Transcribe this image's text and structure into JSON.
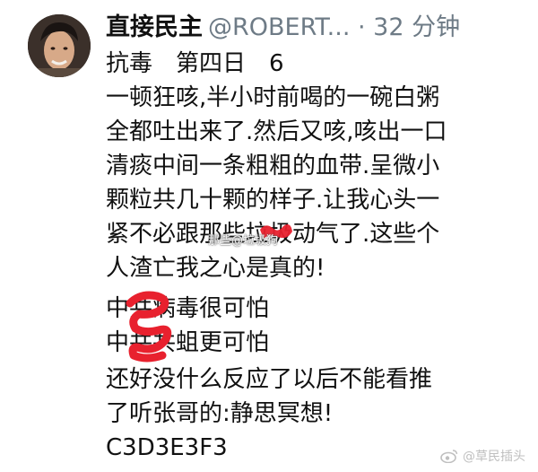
{
  "post": {
    "author_name": "直接民主",
    "author_handle": "@ROBERT...",
    "time": " · 32 分钟",
    "lines": [
      "抗毒　第四日　6",
      "一顿狂咳,半小时前喝的一碗白粥",
      "全都吐出来了.然后又咳,咳出一口",
      "清痰中间一条粗粗的血带.呈微小",
      "颗粒共几十颗的样子.让我心头一",
      "紧不必跟那些垃圾动气了.这些个",
      "人渣亡我之心是真的!",
      "中共病毒很可怕",
      "中共共蛆更可怕",
      "还好没什么反应了以后不能看推",
      "了听张哥的:静思冥想!",
      "C3D3E3F3"
    ]
  },
  "watermarks": {
    "center": "那些@垃圾狗",
    "corner": "@草民插头"
  },
  "colors": {
    "text": "#111111",
    "meta": "#6e7b86",
    "scribble": "#e8212e"
  },
  "icons": {
    "avatar": "profile-photo",
    "corner_logo": "weibo-icon"
  }
}
